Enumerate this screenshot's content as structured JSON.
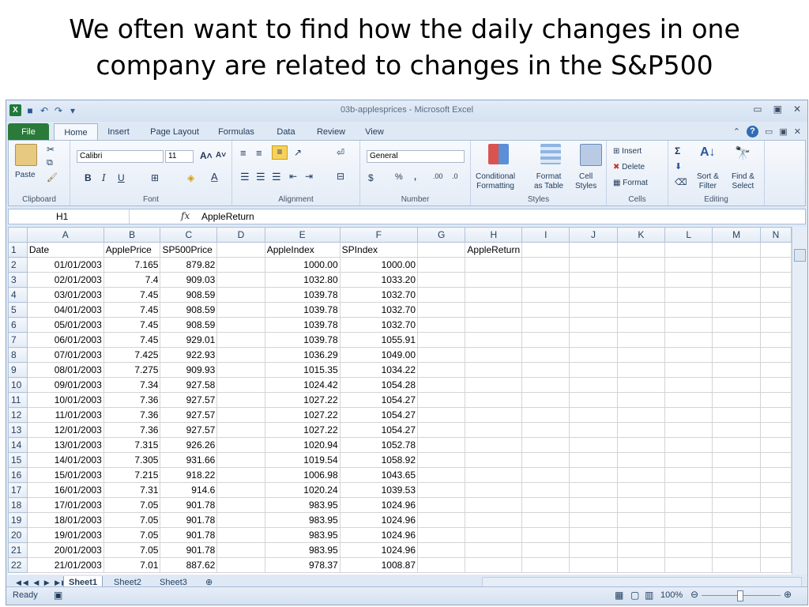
{
  "slide": {
    "title_line1": "We often want to find how the daily changes in one",
    "title_line2": "company are related to changes in the S&P500"
  },
  "window": {
    "title": "03b-applesprices - Microsoft Excel"
  },
  "tabs": [
    "File",
    "Home",
    "Insert",
    "Page Layout",
    "Formulas",
    "Data",
    "Review",
    "View"
  ],
  "ribbon": {
    "clipboard": {
      "paste": "Paste",
      "label": "Clipboard"
    },
    "font": {
      "name": "Calibri",
      "size": "11",
      "label": "Font"
    },
    "alignment": {
      "label": "Alignment"
    },
    "number": {
      "format": "General",
      "label": "Number"
    },
    "styles": {
      "conditional": "Conditional",
      "conditional2": "Formatting",
      "format_table": "Format",
      "format_table2": "as Table",
      "cell_styles": "Cell",
      "cell_styles2": "Styles",
      "label": "Styles"
    },
    "cells": {
      "insert": "Insert",
      "delete": "Delete",
      "format": "Format",
      "label": "Cells"
    },
    "editing": {
      "sort": "Sort &",
      "sort2": "Filter",
      "find": "Find &",
      "find2": "Select",
      "label": "Editing"
    }
  },
  "formula_bar": {
    "name_box": "H1",
    "fx": "fx",
    "formula": "AppleReturn"
  },
  "columns": [
    "A",
    "B",
    "C",
    "D",
    "E",
    "F",
    "G",
    "H",
    "I",
    "J",
    "K",
    "L",
    "M",
    "N"
  ],
  "header_row": {
    "A": "Date",
    "B": "ApplePrice",
    "C": "SP500Price",
    "D": "",
    "E": "AppleIndex",
    "F": "SPIndex",
    "G": "",
    "H": "AppleReturn"
  },
  "rows": [
    [
      "01/01/2003",
      "7.165",
      "879.82",
      "1000.00",
      "1000.00"
    ],
    [
      "02/01/2003",
      "7.4",
      "909.03",
      "1032.80",
      "1033.20"
    ],
    [
      "03/01/2003",
      "7.45",
      "908.59",
      "1039.78",
      "1032.70"
    ],
    [
      "04/01/2003",
      "7.45",
      "908.59",
      "1039.78",
      "1032.70"
    ],
    [
      "05/01/2003",
      "7.45",
      "908.59",
      "1039.78",
      "1032.70"
    ],
    [
      "06/01/2003",
      "7.45",
      "929.01",
      "1039.78",
      "1055.91"
    ],
    [
      "07/01/2003",
      "7.425",
      "922.93",
      "1036.29",
      "1049.00"
    ],
    [
      "08/01/2003",
      "7.275",
      "909.93",
      "1015.35",
      "1034.22"
    ],
    [
      "09/01/2003",
      "7.34",
      "927.58",
      "1024.42",
      "1054.28"
    ],
    [
      "10/01/2003",
      "7.36",
      "927.57",
      "1027.22",
      "1054.27"
    ],
    [
      "11/01/2003",
      "7.36",
      "927.57",
      "1027.22",
      "1054.27"
    ],
    [
      "12/01/2003",
      "7.36",
      "927.57",
      "1027.22",
      "1054.27"
    ],
    [
      "13/01/2003",
      "7.315",
      "926.26",
      "1020.94",
      "1052.78"
    ],
    [
      "14/01/2003",
      "7.305",
      "931.66",
      "1019.54",
      "1058.92"
    ],
    [
      "15/01/2003",
      "7.215",
      "918.22",
      "1006.98",
      "1043.65"
    ],
    [
      "16/01/2003",
      "7.31",
      "914.6",
      "1020.24",
      "1039.53"
    ],
    [
      "17/01/2003",
      "7.05",
      "901.78",
      "983.95",
      "1024.96"
    ],
    [
      "18/01/2003",
      "7.05",
      "901.78",
      "983.95",
      "1024.96"
    ],
    [
      "19/01/2003",
      "7.05",
      "901.78",
      "983.95",
      "1024.96"
    ],
    [
      "20/01/2003",
      "7.05",
      "901.78",
      "983.95",
      "1024.96"
    ],
    [
      "21/01/2003",
      "7.01",
      "887.62",
      "978.37",
      "1008.87"
    ]
  ],
  "sheets": [
    "Sheet1",
    "Sheet2",
    "Sheet3"
  ],
  "status": {
    "ready": "Ready",
    "zoom": "100%"
  }
}
